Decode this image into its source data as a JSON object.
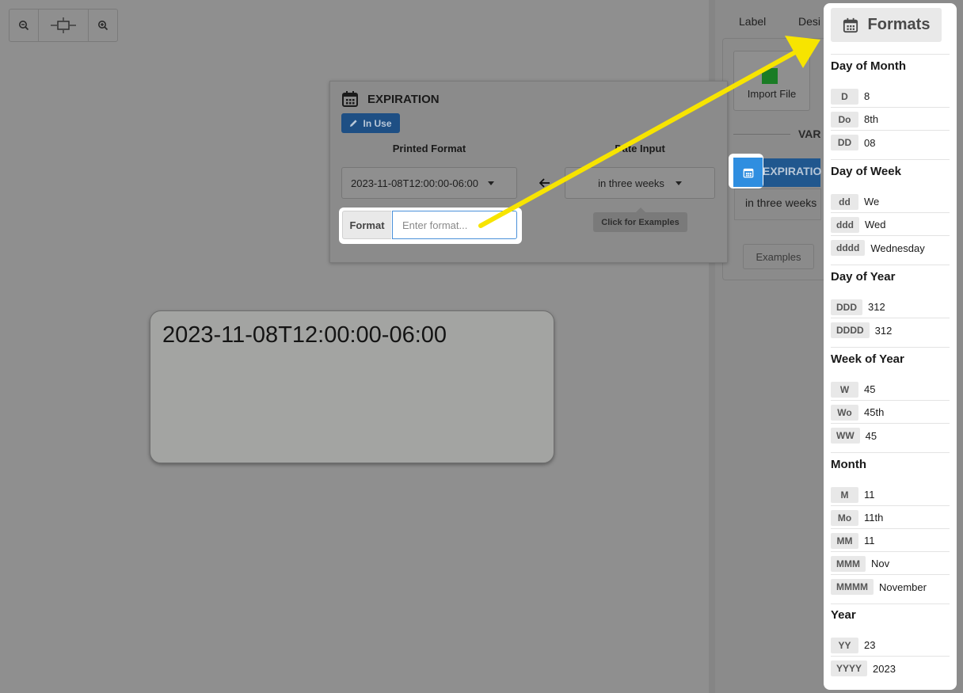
{
  "toolbar": {
    "zoom_out_icon": "zoom-out-icon",
    "fit_icon": "fit-width-icon",
    "zoom_in_icon": "zoom-in-icon"
  },
  "right_panel": {
    "tabs": [
      "Label",
      "Desi"
    ],
    "import_label": "Import File",
    "variables_heading": "VAR",
    "variable_chip": "EXPIRATIO",
    "variable_value": "in three weeks",
    "examples_button": "Examples"
  },
  "expiration": {
    "title": "EXPIRATION",
    "in_use": "In Use",
    "printed_format_heading": "Printed Format",
    "date_input_heading": "Date Input",
    "printed_format_value": "2023-11-08T12:00:00-06:00",
    "date_input_value": "in three weeks",
    "click_for_examples": "Click for Examples",
    "format_label": "Format",
    "format_placeholder": "Enter format..."
  },
  "label_preview": {
    "text": "2023-11-08T12:00:00-06:00"
  },
  "formats": {
    "title": "Formats",
    "groups": [
      {
        "title": "Day of Month",
        "items": [
          {
            "token": "D",
            "example": "8"
          },
          {
            "token": "Do",
            "example": "8th"
          },
          {
            "token": "DD",
            "example": "08"
          }
        ]
      },
      {
        "title": "Day of Week",
        "items": [
          {
            "token": "dd",
            "example": "We"
          },
          {
            "token": "ddd",
            "example": "Wed"
          },
          {
            "token": "dddd",
            "example": "Wednesday"
          }
        ]
      },
      {
        "title": "Day of Year",
        "items": [
          {
            "token": "DDD",
            "example": "312"
          },
          {
            "token": "DDDD",
            "example": "312"
          }
        ]
      },
      {
        "title": "Week of Year",
        "items": [
          {
            "token": "W",
            "example": "45"
          },
          {
            "token": "Wo",
            "example": "45th"
          },
          {
            "token": "WW",
            "example": "45"
          }
        ]
      },
      {
        "title": "Month",
        "items": [
          {
            "token": "M",
            "example": "11"
          },
          {
            "token": "Mo",
            "example": "11th"
          },
          {
            "token": "MM",
            "example": "11"
          },
          {
            "token": "MMM",
            "example": "Nov"
          },
          {
            "token": "MMMM",
            "example": "November"
          }
        ]
      },
      {
        "title": "Year",
        "items": [
          {
            "token": "YY",
            "example": "23"
          },
          {
            "token": "YYYY",
            "example": "2023"
          }
        ]
      }
    ]
  },
  "colors": {
    "accent_blue": "#2f8ee0",
    "in_use_blue": "#1e4f84",
    "arrow_yellow": "#f7e400",
    "import_green": "#1a7c25"
  }
}
